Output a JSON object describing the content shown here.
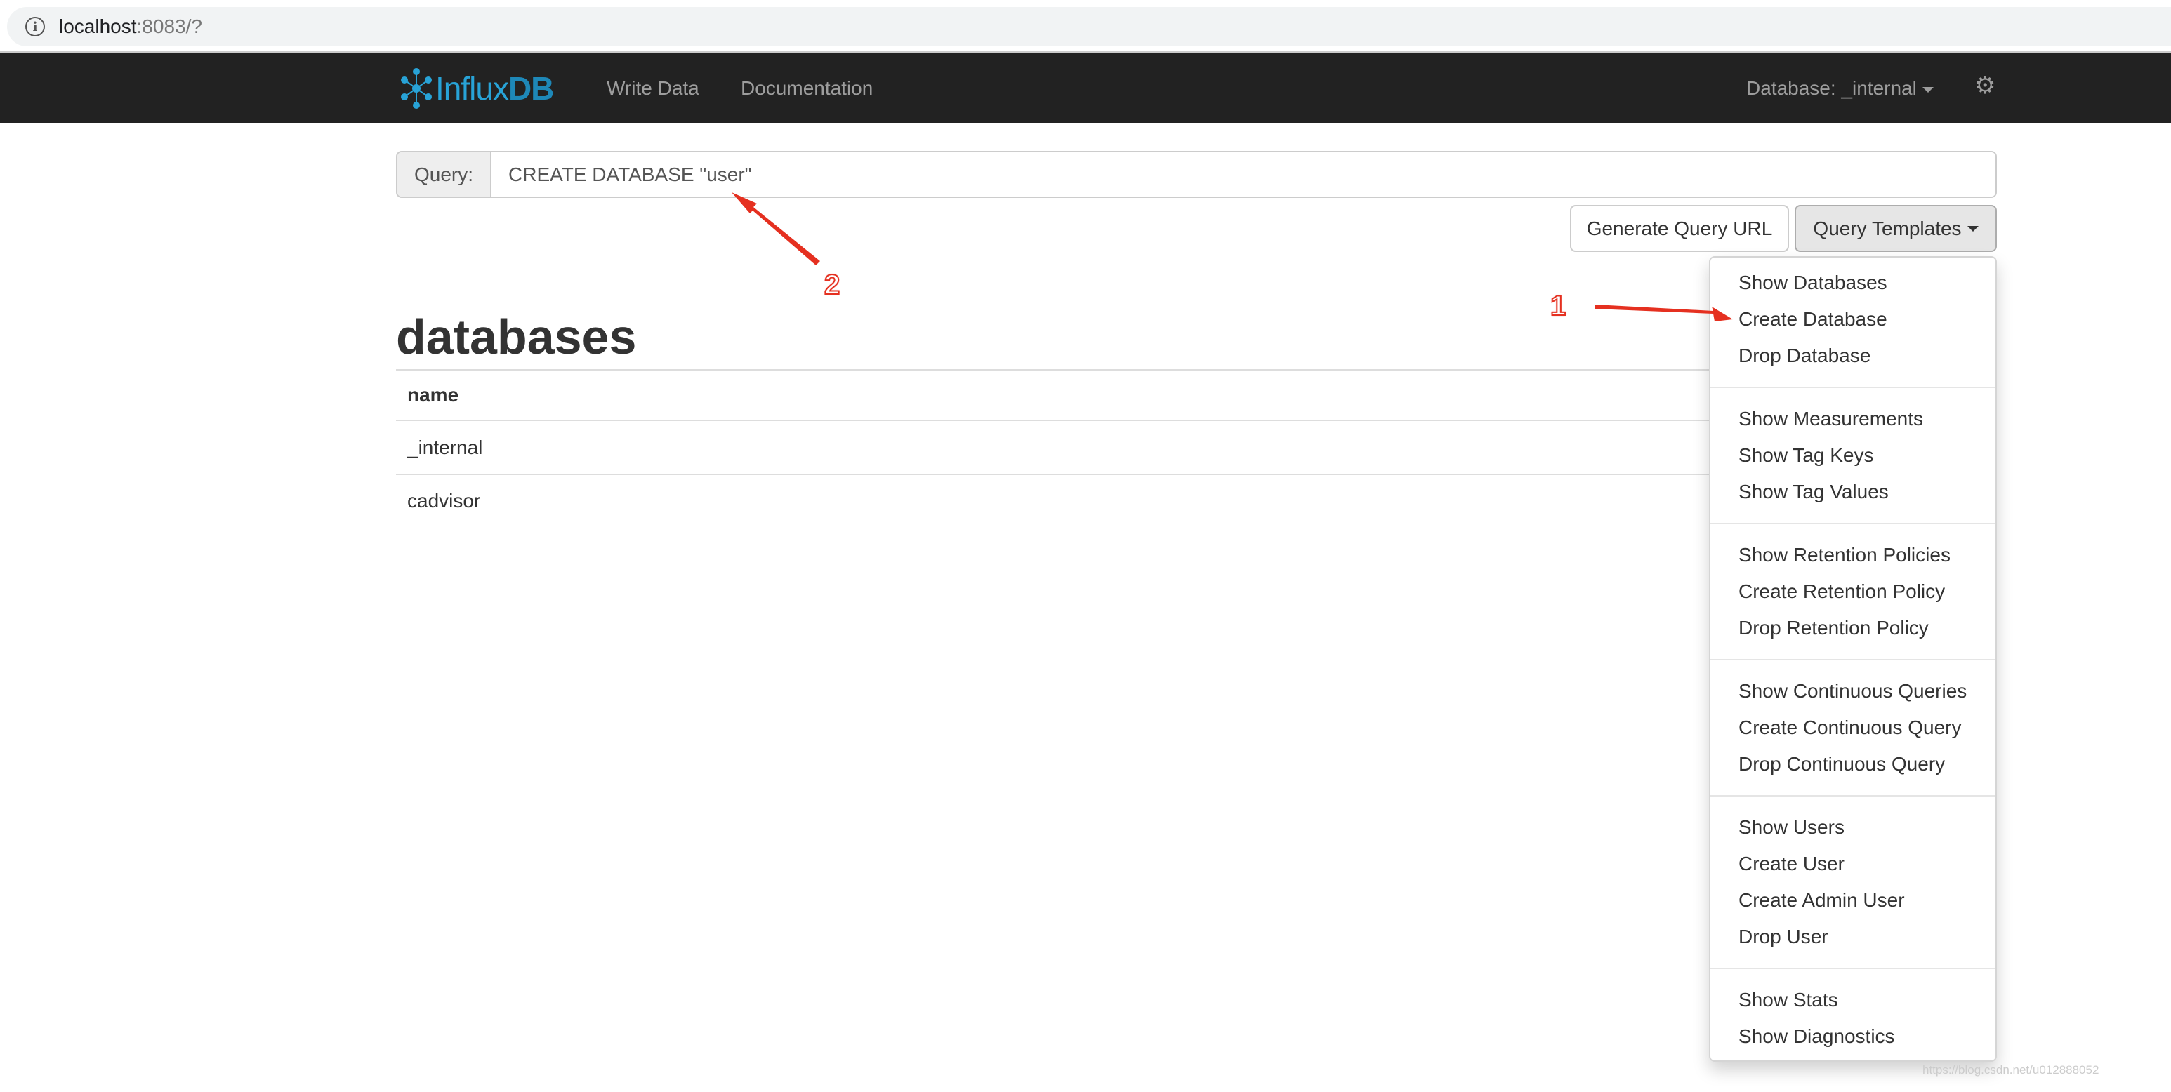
{
  "browser": {
    "url_host": "localhost",
    "url_rest": ":8083/?"
  },
  "navbar": {
    "logo": {
      "part1": "Influx",
      "part2": "DB"
    },
    "links": [
      "Write Data",
      "Documentation"
    ],
    "database_label": "Database: _internal"
  },
  "query": {
    "label": "Query:",
    "value": "CREATE DATABASE \"user\""
  },
  "buttons": {
    "generate": "Generate Query URL",
    "templates": "Query Templates"
  },
  "results": {
    "title": "databases",
    "column": "name",
    "rows": [
      "_internal",
      "cadvisor"
    ]
  },
  "templates_menu": [
    [
      "Show Databases",
      "Create Database",
      "Drop Database"
    ],
    [
      "Show Measurements",
      "Show Tag Keys",
      "Show Tag Values"
    ],
    [
      "Show Retention Policies",
      "Create Retention Policy",
      "Drop Retention Policy"
    ],
    [
      "Show Continuous Queries",
      "Create Continuous Query",
      "Drop Continuous Query"
    ],
    [
      "Show Users",
      "Create User",
      "Create Admin User",
      "Drop User"
    ],
    [
      "Show Stats",
      "Show Diagnostics"
    ]
  ],
  "annotations": {
    "one": "1",
    "two": "2",
    "color": "#e53020"
  },
  "watermark": "https://blog.csdn.net/u012888052"
}
